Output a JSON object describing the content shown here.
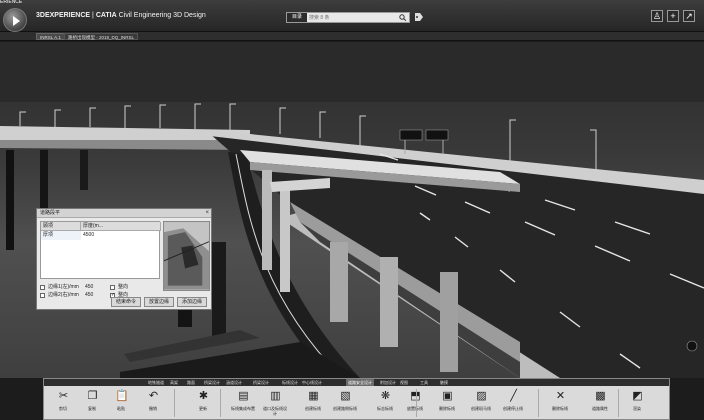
{
  "window": {
    "title_fragment": "ERIENCE"
  },
  "header": {
    "brand": "3DEXPERIENCE",
    "separator": "|",
    "app_prefix": "CATIA",
    "app_name": "Civil Engineering 3D Design"
  },
  "search": {
    "scope_label": "目录",
    "placeholder": "搜索 8 条"
  },
  "tabs": [
    {
      "label": "INRSL A.1"
    },
    {
      "label": "路桥出现模型 - 2018_DQ_INRSL"
    }
  ],
  "dialog": {
    "title": "道路段平",
    "close_label": "×",
    "table": {
      "headers": [
        "顾项",
        "厚度(m..."
      ],
      "rows": [
        [
          "厚项",
          "4500"
        ]
      ]
    },
    "params": [
      {
        "label": "边缘1(左)/mm",
        "value": "450",
        "check_label": "整向",
        "checked": false
      },
      {
        "label": "边缘2(右)/mm",
        "value": "450",
        "check_label": "整向",
        "checked": true
      }
    ],
    "buttons": [
      "结束命令",
      "放置边缘",
      "添加边缘"
    ]
  },
  "toolbar": {
    "categories": [
      {
        "label": "地铁隧道",
        "active": false
      },
      {
        "label": "高架",
        "active": false
      },
      {
        "label": "路面",
        "active": false
      },
      {
        "label": "桥梁设计",
        "active": false
      },
      {
        "label": "涵道设计",
        "active": false
      },
      {
        "label": "桥梁设计",
        "active": false
      },
      {
        "label": "标线设计",
        "active": false
      },
      {
        "label": "中心线设计",
        "active": false
      },
      {
        "label": "道路安全设计",
        "active": true
      },
      {
        "label": "附加设计",
        "active": false
      },
      {
        "label": "视图",
        "active": false
      },
      {
        "label": "工具",
        "active": false
      },
      {
        "label": "触摸",
        "active": false
      }
    ],
    "tools": [
      {
        "label": "剪切",
        "icon": "scissors-icon",
        "glyph": "✂"
      },
      {
        "label": "复制",
        "icon": "copy-icon",
        "glyph": "❐"
      },
      {
        "label": "粘贴",
        "icon": "paste-icon",
        "glyph": "📋"
      },
      {
        "label": "撤销",
        "icon": "undo-icon",
        "glyph": "↶"
      },
      {
        "label": "更新",
        "icon": "update-icon",
        "glyph": "✱"
      },
      {
        "label": "标线集成布置",
        "icon": "lane-marking-icon",
        "glyph": "▤"
      },
      {
        "label": "道口及标线设计",
        "icon": "junction-marking-icon",
        "glyph": "▥"
      },
      {
        "label": "创建标线",
        "icon": "create-marking-icon",
        "glyph": "▦"
      },
      {
        "label": "创建路侧标线",
        "icon": "roadside-marking-icon",
        "glyph": "▧"
      },
      {
        "label": "标志标线",
        "icon": "sign-marking-icon",
        "glyph": "❋"
      },
      {
        "label": "放置标线",
        "icon": "place-marking-icon",
        "glyph": "⬒"
      },
      {
        "label": "删除标线",
        "icon": "delete-marking-icon",
        "glyph": "▣"
      },
      {
        "label": "创建斑马线",
        "icon": "zebra-crossing-icon",
        "glyph": "▨"
      },
      {
        "label": "创建停止线",
        "icon": "stop-line-icon",
        "glyph": "╱"
      },
      {
        "label": "删除标线",
        "icon": "remove-marking-icon",
        "glyph": "✕"
      },
      {
        "label": "道路属性",
        "icon": "road-properties-icon",
        "glyph": "▩"
      },
      {
        "label": "渲染",
        "icon": "render-icon",
        "glyph": "◩"
      }
    ]
  }
}
